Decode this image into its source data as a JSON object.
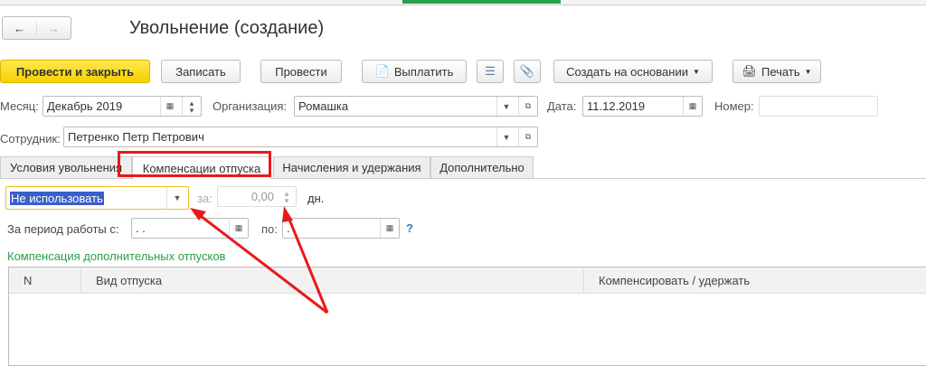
{
  "title": "Увольнение (создание)",
  "toolbar": {
    "post_close": "Провести и закрыть",
    "save": "Записать",
    "post": "Провести",
    "pay": "Выплатить",
    "create_based": "Создать на основании",
    "print": "Печать"
  },
  "fields": {
    "month_label": "Месяц:",
    "month": "Декабрь 2019",
    "org_label": "Организация:",
    "org": "Ромашка",
    "date_label": "Дата:",
    "date": "11.12.2019",
    "number_label": "Номер:",
    "number": "",
    "employee_label": "Сотрудник:",
    "employee": "Петренко Петр Петрович"
  },
  "tabs": [
    "Условия увольнения",
    "Компенсации отпуска",
    "Начисления и удержания",
    "Дополнительно"
  ],
  "comp": {
    "mode": "Не использовать",
    "for_label": "за:",
    "days": "0,00",
    "days_unit": "дн.",
    "period_label": "За период работы с:",
    "period_from": " .  .",
    "to_label": "по:",
    "period_to": " .  .",
    "help": "?"
  },
  "section": "Компенсация дополнительных отпусков",
  "table": {
    "headers": [
      "N",
      "Вид отпуска",
      "Компенсировать / удержать"
    ]
  },
  "colors": {
    "accent": "#f5d000",
    "annotation": "#e8191a",
    "section": "#27a04a"
  }
}
